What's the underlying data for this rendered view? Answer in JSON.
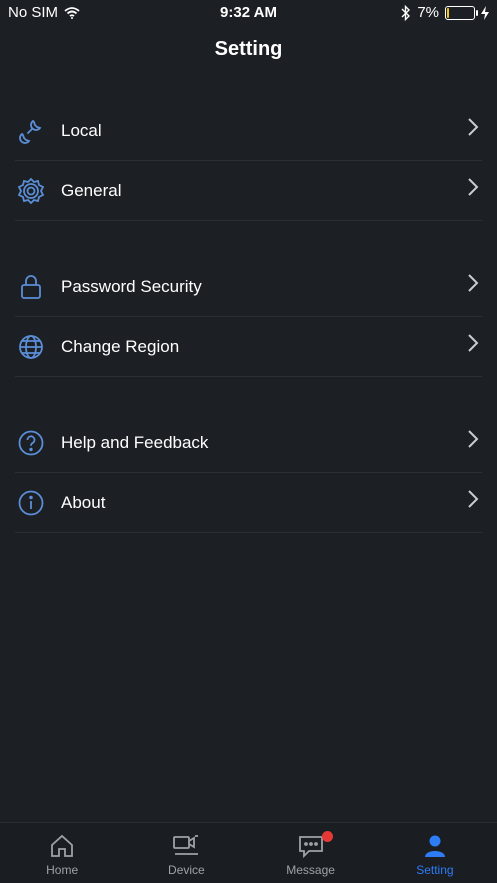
{
  "status_bar": {
    "carrier": "No SIM",
    "time": "9:32 AM",
    "battery_percent": "7%",
    "battery_level": 0.07
  },
  "header": {
    "title": "Setting"
  },
  "groups": [
    {
      "items": [
        {
          "label": "Local",
          "icon": "wrench-icon"
        },
        {
          "label": "General",
          "icon": "gear-icon"
        }
      ]
    },
    {
      "items": [
        {
          "label": "Password Security",
          "icon": "lock-icon"
        },
        {
          "label": "Change Region",
          "icon": "globe-icon"
        }
      ]
    },
    {
      "items": [
        {
          "label": "Help and Feedback",
          "icon": "help-icon"
        },
        {
          "label": "About",
          "icon": "info-icon"
        }
      ]
    }
  ],
  "tabbar": {
    "tabs": [
      {
        "label": "Home",
        "icon": "home-icon"
      },
      {
        "label": "Device",
        "icon": "device-icon"
      },
      {
        "label": "Message",
        "icon": "message-icon"
      },
      {
        "label": "Setting",
        "icon": "user-icon",
        "active": true
      }
    ]
  },
  "colors": {
    "background": "#1c1f24",
    "accent": "#2e7cf6",
    "icon_blue": "#5b8ed6",
    "badge": "#e53935",
    "battery": "#f5c518"
  }
}
